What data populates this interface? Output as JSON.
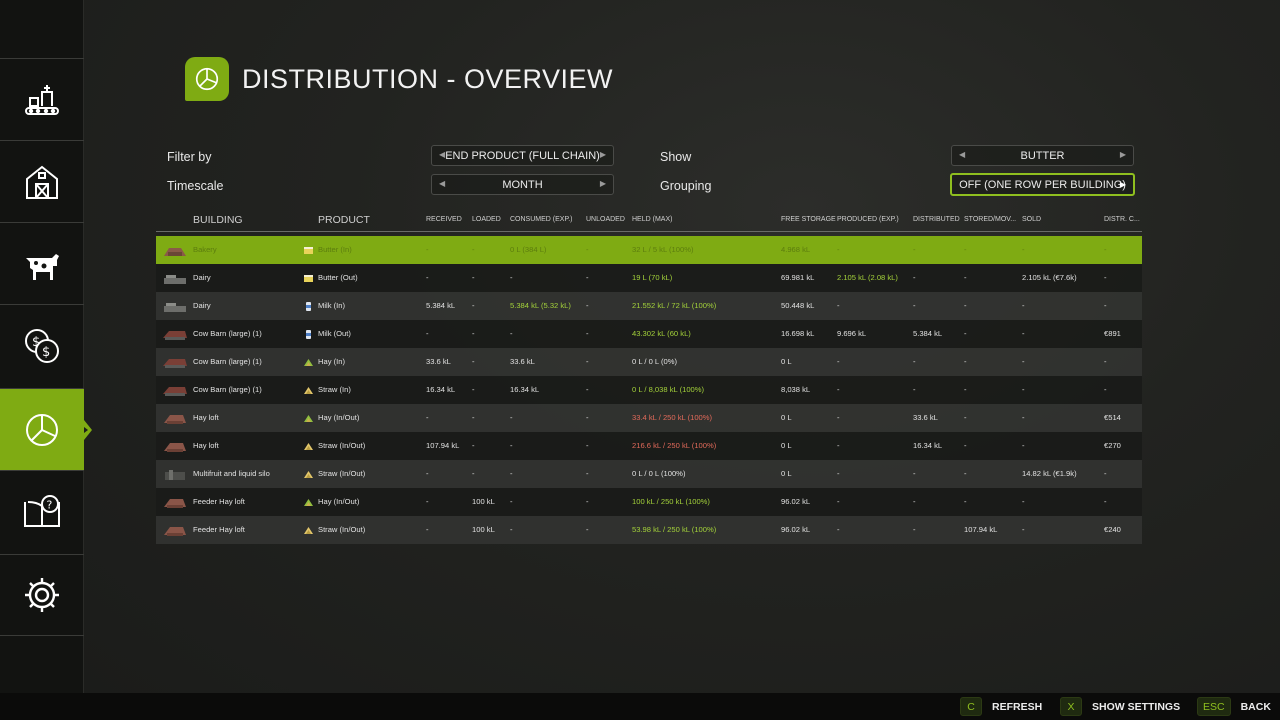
{
  "header": {
    "title": "DISTRIBUTION - OVERVIEW"
  },
  "filters": {
    "filter_by_label": "Filter by",
    "filter_by_value": "END PRODUCT (FULL CHAIN)",
    "timescale_label": "Timescale",
    "timescale_value": "MONTH",
    "show_label": "Show",
    "show_value": "BUTTER",
    "grouping_label": "Grouping",
    "grouping_value": "OFF (ONE ROW PER BUILDING)"
  },
  "table": {
    "headers": {
      "building": "BUILDING",
      "product": "PRODUCT",
      "received": "RECEIVED",
      "loaded": "LOADED",
      "consumed": "CONSUMED (EXP.)",
      "unloaded": "UNLOADED",
      "held": "HELD (MAX)",
      "free_storage": "FREE STORAGE",
      "produced": "PRODUCED (EXP.)",
      "distributed": "DISTRIBUTED",
      "stored": "STORED/MOV...",
      "sold": "SOLD",
      "distr_cost": "DISTR. C..."
    },
    "rows": [
      {
        "building": "Bakery",
        "product": "Butter (In)",
        "received": "-",
        "loaded": "-",
        "consumed": "0 L  (384 L)",
        "unloaded": "-",
        "held": "32 L / 5 kL (100%)",
        "free": "4.968 kL",
        "produced": "-",
        "distributed": "-",
        "stored": "-",
        "sold": "-",
        "cost": "-"
      },
      {
        "building": "Dairy",
        "product": "Butter (Out)",
        "received": "-",
        "loaded": "-",
        "consumed": "-",
        "unloaded": "-",
        "held": "19 L (70 kL)",
        "free": "69.981 kL",
        "produced": "2.105 kL  (2.08 kL)",
        "distributed": "-",
        "stored": "-",
        "sold": "2.105 kL  (€7.6k)",
        "cost": "-"
      },
      {
        "building": "Dairy",
        "product": "Milk (In)",
        "received": "5.384 kL",
        "loaded": "-",
        "consumed": "5.384 kL  (5.32 kL)",
        "unloaded": "-",
        "held": "21.552 kL / 72 kL (100%)",
        "free": "50.448 kL",
        "produced": "-",
        "distributed": "-",
        "stored": "-",
        "sold": "-",
        "cost": "-"
      },
      {
        "building": "Cow Barn (large) (1)",
        "product": "Milk (Out)",
        "received": "-",
        "loaded": "-",
        "consumed": "-",
        "unloaded": "-",
        "held": "43.302 kL (60 kL)",
        "free": "16.698 kL",
        "produced": "9.696 kL",
        "distributed": "5.384 kL",
        "stored": "-",
        "sold": "-",
        "cost": "€891"
      },
      {
        "building": "Cow Barn (large) (1)",
        "product": "Hay (In)",
        "received": "33.6 kL",
        "loaded": "-",
        "consumed": "33.6 kL",
        "unloaded": "-",
        "held": "0 L / 0 L (0%)",
        "free": "0 L",
        "produced": "-",
        "distributed": "-",
        "stored": "-",
        "sold": "-",
        "cost": "-"
      },
      {
        "building": "Cow Barn (large) (1)",
        "product": "Straw (In)",
        "received": "16.34 kL",
        "loaded": "-",
        "consumed": "16.34 kL",
        "unloaded": "-",
        "held": "0 L / 8,038 kL (100%)",
        "free": "8,038 kL",
        "produced": "-",
        "distributed": "-",
        "stored": "-",
        "sold": "-",
        "cost": "-"
      },
      {
        "building": "Hay loft",
        "product": "Hay (In/Out)",
        "received": "-",
        "loaded": "-",
        "consumed": "-",
        "unloaded": "-",
        "held": "33.4 kL / 250 kL (100%)",
        "free": "0 L",
        "produced": "-",
        "distributed": "33.6 kL",
        "stored": "-",
        "sold": "-",
        "cost": "€514"
      },
      {
        "building": "Hay loft",
        "product": "Straw (In/Out)",
        "received": "107.94 kL",
        "loaded": "-",
        "consumed": "-",
        "unloaded": "-",
        "held": "216.6 kL / 250 kL (100%)",
        "free": "0 L",
        "produced": "-",
        "distributed": "16.34 kL",
        "stored": "-",
        "sold": "-",
        "cost": "€270"
      },
      {
        "building": "Multifruit and liquid silo",
        "product": "Straw (In/Out)",
        "received": "-",
        "loaded": "-",
        "consumed": "-",
        "unloaded": "-",
        "held": "0 L / 0 L (100%)",
        "free": "0 L",
        "produced": "-",
        "distributed": "-",
        "stored": "-",
        "sold": "14.82 kL  (€1.9k)",
        "cost": "-"
      },
      {
        "building": "Feeder Hay loft",
        "product": "Hay (In/Out)",
        "received": "-",
        "loaded": "100 kL",
        "consumed": "-",
        "unloaded": "-",
        "held": "100 kL / 250 kL (100%)",
        "free": "96.02 kL",
        "produced": "-",
        "distributed": "-",
        "stored": "-",
        "sold": "-",
        "cost": "-"
      },
      {
        "building": "Feeder Hay loft",
        "product": "Straw (In/Out)",
        "received": "-",
        "loaded": "100 kL",
        "consumed": "-",
        "unloaded": "-",
        "held": "53.98 kL / 250 kL (100%)",
        "free": "96.02 kL",
        "produced": "-",
        "distributed": "-",
        "stored": "107.94 kL",
        "sold": "-",
        "cost": "€240"
      }
    ]
  },
  "row_styles": {
    "selected_row": 0,
    "held_colors": [
      "g",
      "g",
      "g",
      "g",
      "",
      "g",
      "r",
      "r",
      "",
      "g",
      "g"
    ],
    "consumed_colors": [
      "",
      "",
      "g",
      "",
      "",
      "",
      "",
      "",
      "",
      "",
      ""
    ],
    "produced_colors": [
      "",
      "g",
      "",
      "",
      "",
      "",
      "",
      "",
      "",
      "",
      ""
    ],
    "product_icons": [
      "butter-icon",
      "butter-icon",
      "milk-icon",
      "milk-icon",
      "hay-icon",
      "straw-icon",
      "hay-icon",
      "straw-icon",
      "straw-icon",
      "hay-icon",
      "straw-icon"
    ],
    "building_icons": [
      "bakery-icon",
      "dairy-icon",
      "dairy-icon",
      "barn-icon",
      "barn-icon",
      "barn-icon",
      "hayloft-icon",
      "hayloft-icon",
      "silo-icon",
      "hayloft-icon",
      "hayloft-icon"
    ]
  },
  "sidebar": {
    "items": [
      "production-icon",
      "farm-icon",
      "animals-icon",
      "finances-icon",
      "distribution-icon",
      "help-icon",
      "settings-icon"
    ],
    "active_index": 4
  },
  "bottom_bar": {
    "refresh_key": "C",
    "refresh_label": "REFRESH",
    "settings_key": "X",
    "settings_label": "SHOW SETTINGS",
    "back_key": "ESC",
    "back_label": "BACK"
  },
  "colors": {
    "accent": "#7fab13",
    "positive": "#a3d13a",
    "warning": "#e26a5a"
  }
}
